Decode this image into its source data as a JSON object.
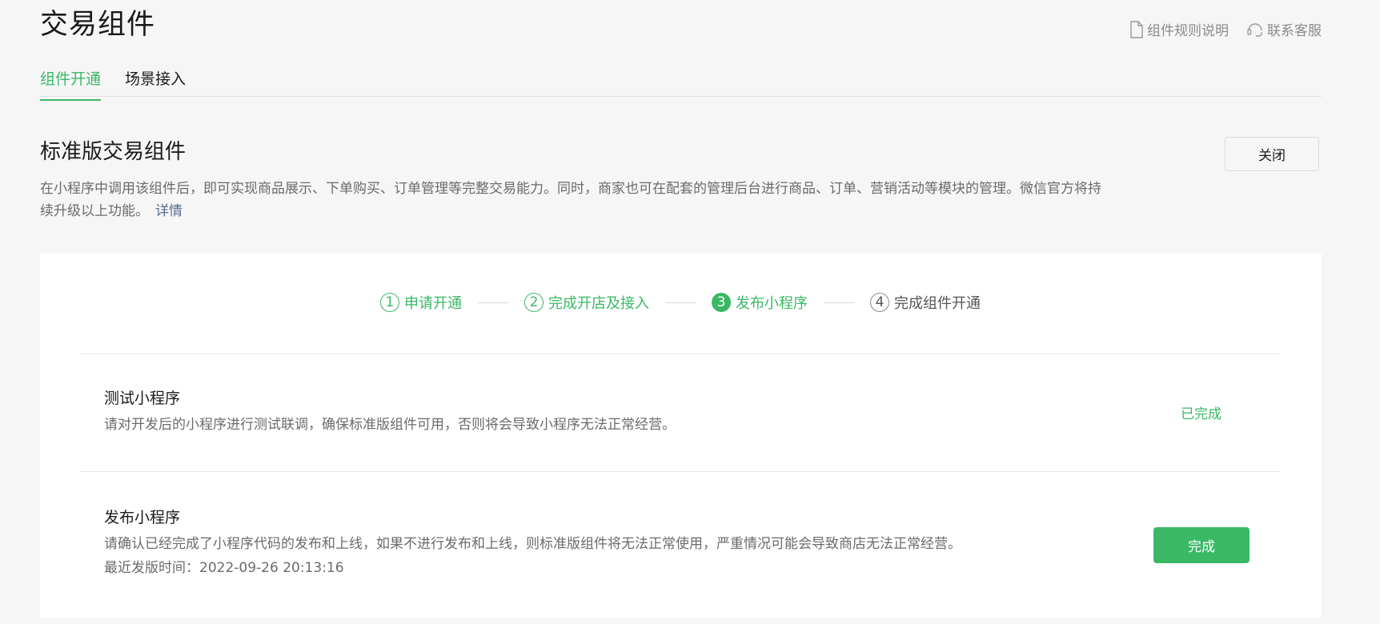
{
  "header": {
    "title": "交易组件",
    "links": {
      "rules": "组件规则说明",
      "support": "联系客服"
    }
  },
  "tabs": [
    {
      "label": "组件开通",
      "active": true
    },
    {
      "label": "场景接入",
      "active": false
    }
  ],
  "component": {
    "title": "标准版交易组件",
    "description": "在小程序中调用该组件后，即可实现商品展示、下单购买、订单管理等完整交易能力。同时，商家也可在配套的管理后台进行商品、订单、营销活动等模块的管理。微信官方将持续升级以上功能。",
    "detail_link": "详情",
    "close_label": "关闭"
  },
  "steps": [
    {
      "num": "1",
      "label": "申请开通",
      "state": "done"
    },
    {
      "num": "2",
      "label": "完成开店及接入",
      "state": "done"
    },
    {
      "num": "3",
      "label": "发布小程序",
      "state": "current"
    },
    {
      "num": "4",
      "label": "完成组件开通",
      "state": "pending"
    }
  ],
  "tasks": [
    {
      "title": "测试小程序",
      "description": "请对开发后的小程序进行测试联调，确保标准版组件可用，否则将会导致小程序无法正常经营。",
      "status": "已完成"
    },
    {
      "title": "发布小程序",
      "description": "请确认已经完成了小程序代码的发布和上线，如果不进行发布和上线，则标准版组件将无法正常使用，严重情况可能会导致商店无法正常经营。",
      "extra": "最近发版时间：2022-09-26 20:13:16",
      "button": "完成"
    }
  ],
  "colors": {
    "accent": "#3ab865",
    "link": "#576b95",
    "background": "#f6f6f6"
  },
  "icons": {
    "rules": "document-icon",
    "support": "headset-icon"
  }
}
